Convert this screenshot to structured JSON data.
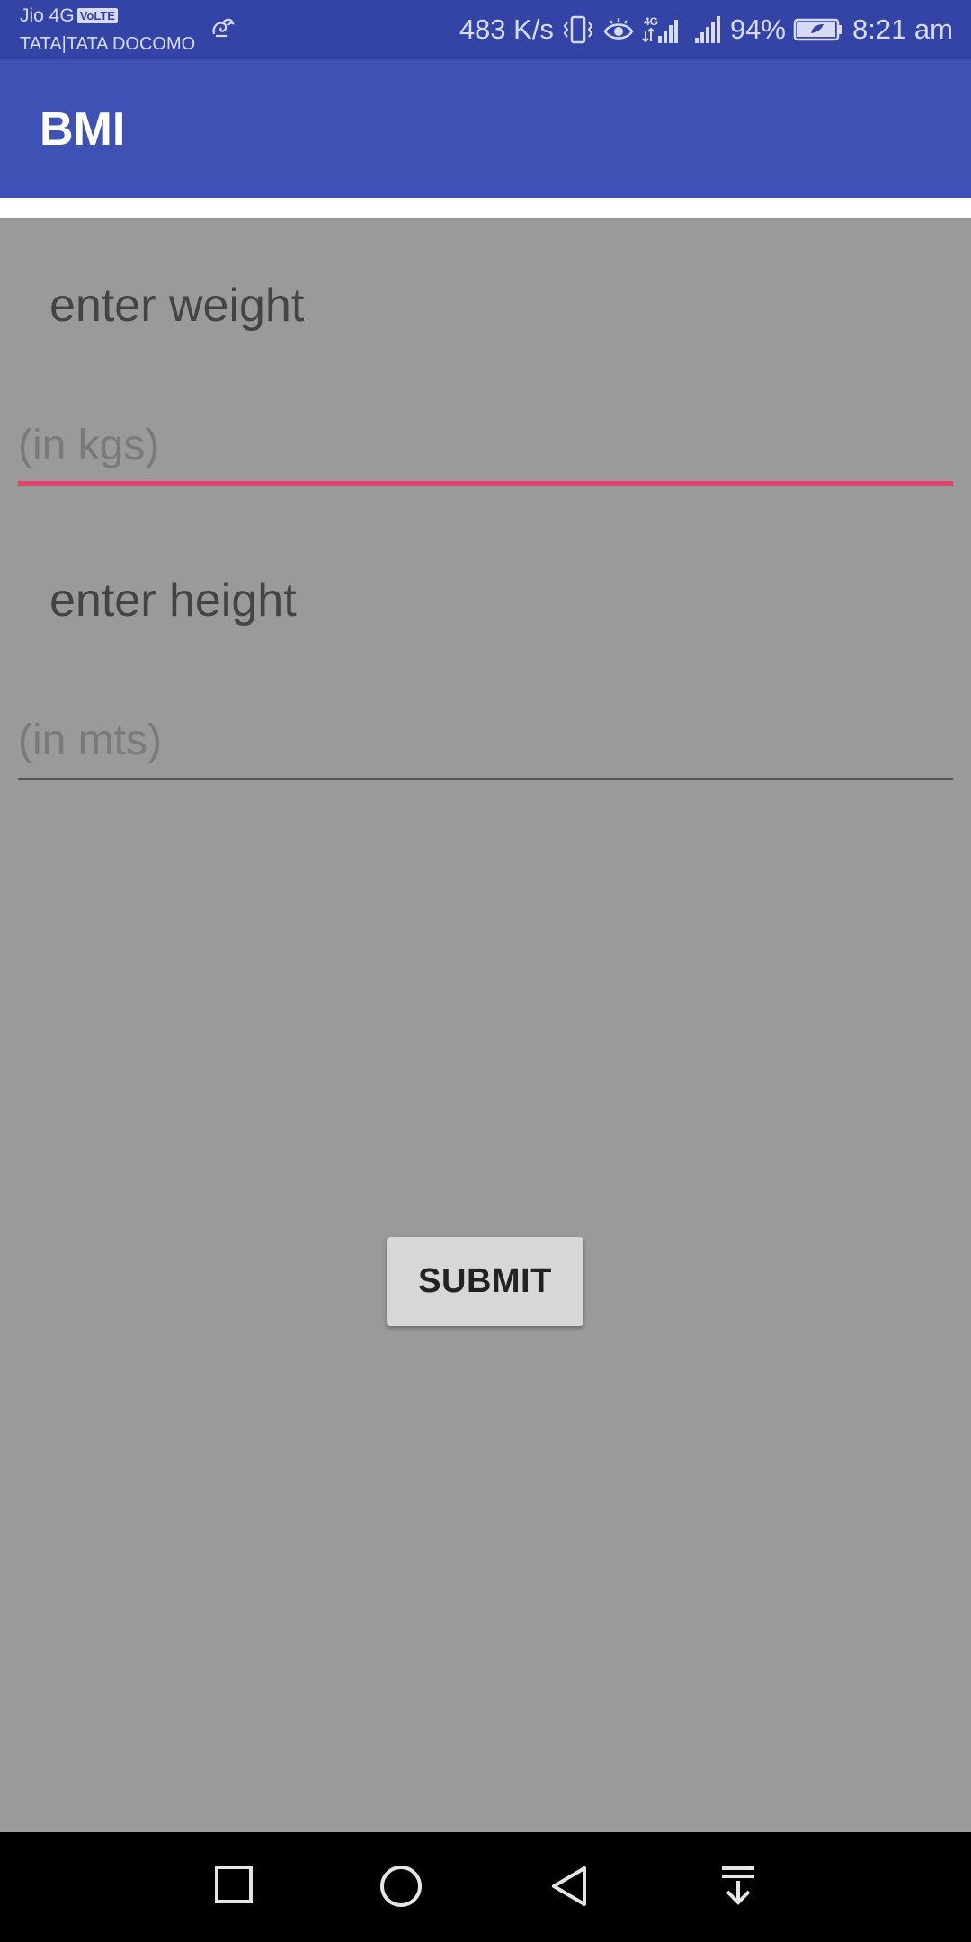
{
  "status_bar": {
    "carrier_primary": "Jio 4G",
    "volte_badge": "VoLTE",
    "carrier_secondary": "TATA|TATA DOCOMO",
    "network_speed": "483 K/s",
    "network_type": "4G",
    "battery": "94%",
    "time": "8:21 am"
  },
  "app_bar": {
    "title": "BMI"
  },
  "form": {
    "weight_label": "enter weight",
    "weight_placeholder": "(in kgs)",
    "height_label": "enter height",
    "height_placeholder": "(in mts)",
    "submit_label": "SUBMIT",
    "focused_underline_color": "#e8416b"
  },
  "colors": {
    "status_bar": "#3443a6",
    "app_bar": "#3f51b5",
    "background": "#9a9a9a",
    "nav_bar": "#000000"
  },
  "nav": {
    "icons": [
      "recents-icon",
      "home-icon",
      "back-icon",
      "notification-pulldown-icon"
    ]
  }
}
